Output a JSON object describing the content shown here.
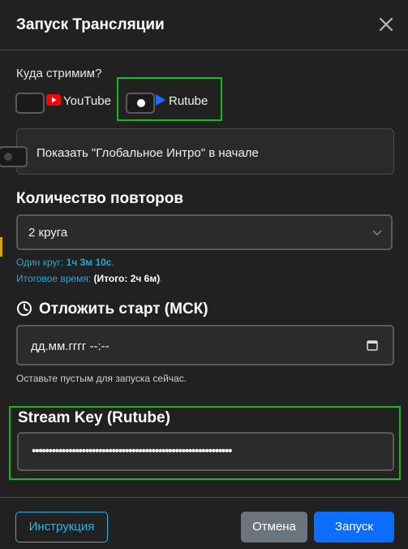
{
  "modal": {
    "title": "Запуск Трансляции"
  },
  "platforms": {
    "label": "Куда стримим?",
    "youtube": {
      "label": "YouTube",
      "checked": false,
      "color": "#ff0000"
    },
    "rutube": {
      "label": "Rutube",
      "checked": true,
      "color": "#1e6bff"
    }
  },
  "intro": {
    "label": "Показать \"Глобальное Интро\" в начале",
    "checked": false
  },
  "repeats": {
    "title": "Количество повторов",
    "selected": "2 круга",
    "one_round_label": "Один круг:",
    "one_round_value": "1ч 3м 10с",
    "total_label": "Итоговое время:",
    "total_value": "(Итого: 2ч 6м)"
  },
  "delay": {
    "title": "Отложить старт (МСК)",
    "placeholder": "дд.мм.гггг --:--",
    "hint": "Оставьте пустым для запуска сейчас."
  },
  "stream_key": {
    "title": "Stream Key (Rutube)",
    "masked_value": "••••••••••••••••••••••••••••••••••••••••••••••••••••••••••••"
  },
  "footer": {
    "guide_label": "Инструкция",
    "cancel_label": "Отмена",
    "start_label": "Запуск"
  },
  "colors": {
    "accent_blue": "#0d6efd",
    "info_cyan": "#22a8d8",
    "highlight_green": "#18b818"
  }
}
